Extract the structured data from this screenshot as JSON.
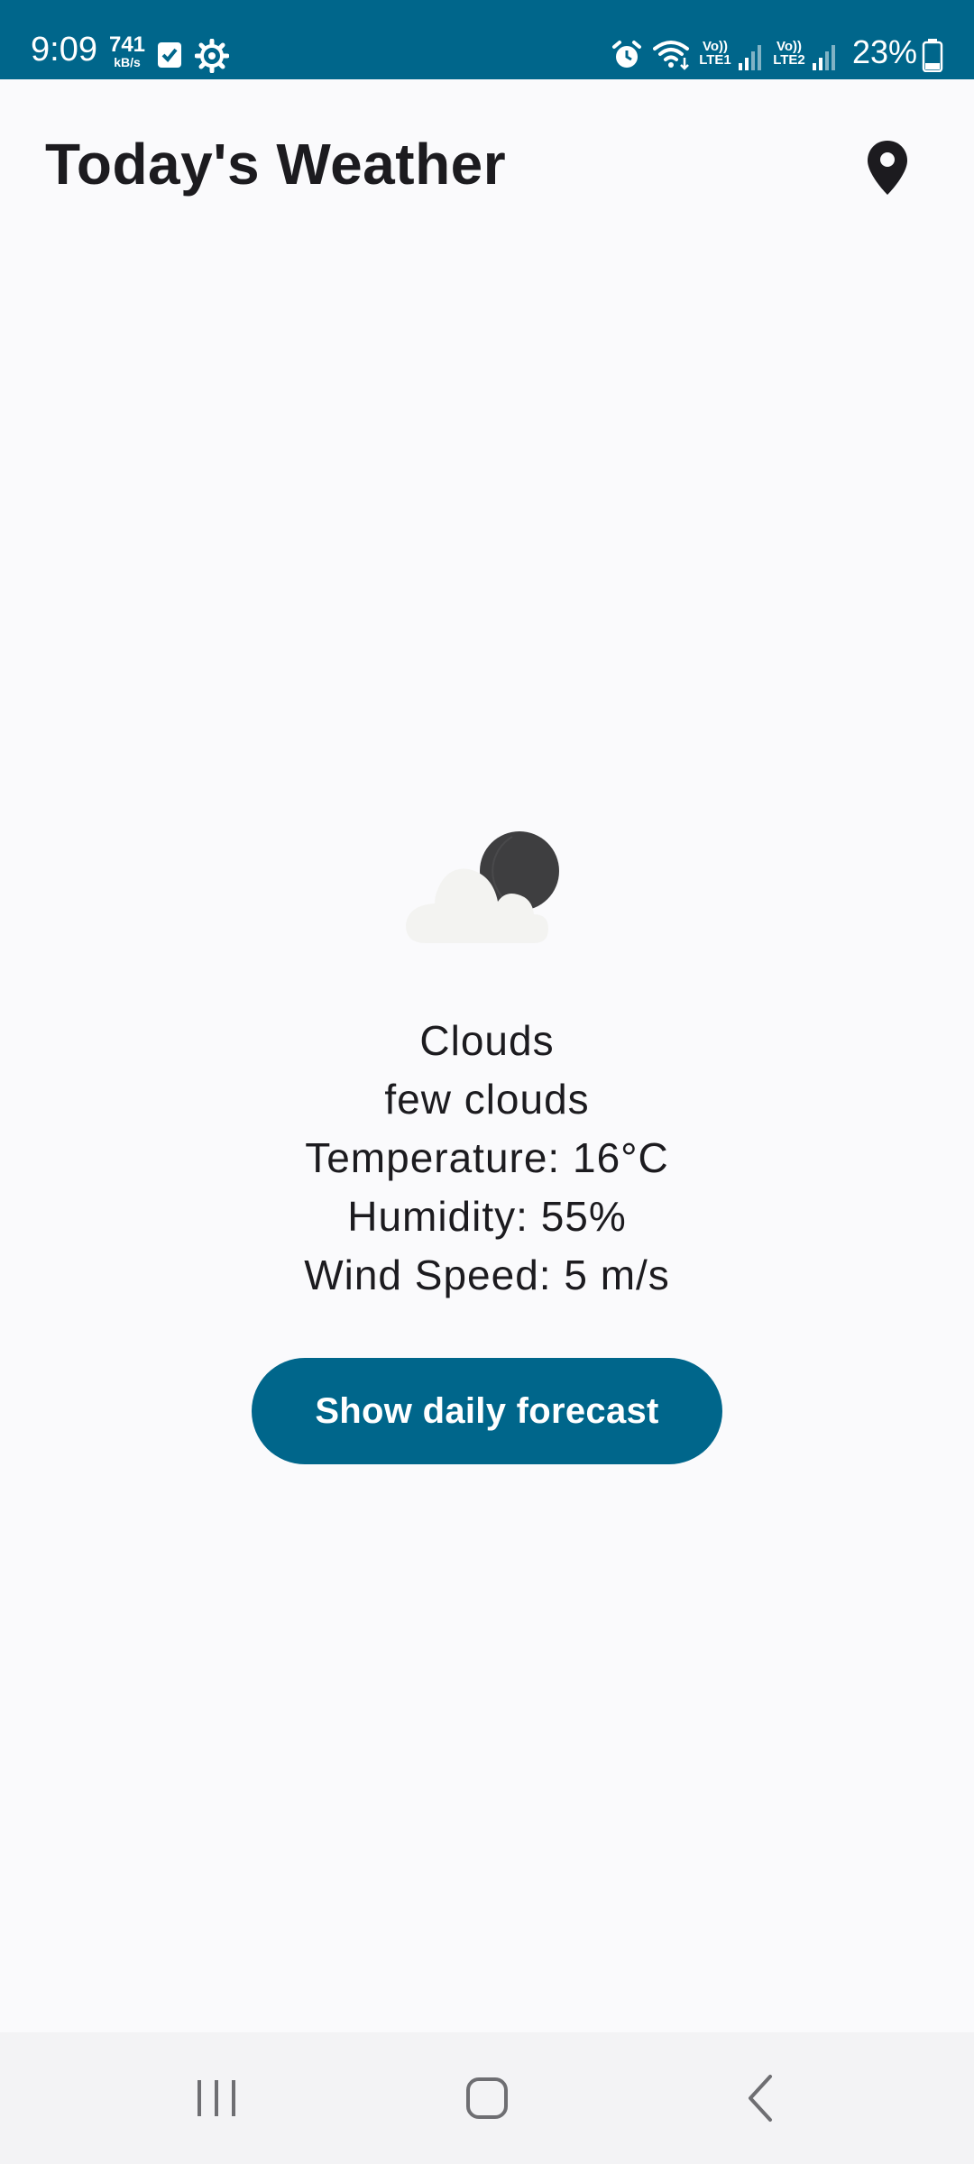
{
  "status_bar": {
    "time": "9:09",
    "net_speed_value": "741",
    "net_speed_unit": "kB/s",
    "sim1_label_top": "Vo))",
    "sim1_label_bottom": "LTE1",
    "sim2_label_top": "Vo))",
    "sim2_label_bottom": "LTE2",
    "battery_percent": "23%",
    "icons": [
      "checkbox-notification-icon",
      "gear-icon",
      "alarm-icon",
      "wifi-icon",
      "signal-icon",
      "battery-icon"
    ]
  },
  "header": {
    "title": "Today's Weather",
    "location_icon": "location-pin-icon"
  },
  "weather": {
    "icon": "cloud-moon-icon",
    "main": "Clouds",
    "description": "few clouds",
    "temperature": "Temperature: 16°C",
    "humidity": "Humidity: 55%",
    "wind_speed": "Wind Speed: 5 m/s"
  },
  "actions": {
    "forecast_button_label": "Show daily forecast"
  },
  "nav_bar": {
    "icons": [
      "recents-icon",
      "home-icon",
      "back-icon"
    ]
  },
  "colors": {
    "accent": "#00668B",
    "background": "#FAFAFC",
    "text": "#1C1B1F",
    "nav_background": "#F3F3F5"
  }
}
